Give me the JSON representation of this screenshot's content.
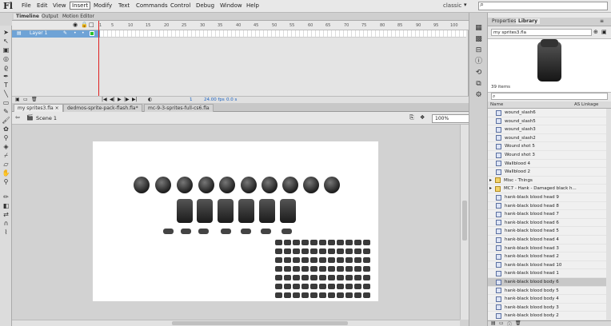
{
  "app": {
    "logo": "Fl",
    "workspace": "classic"
  },
  "menu": [
    "File",
    "Edit",
    "View",
    "Insert",
    "Modify",
    "Text",
    "Commands",
    "Control",
    "Debug",
    "Window",
    "Help"
  ],
  "timeline": {
    "tabs": [
      "Timeline",
      "Output",
      "Motion Editor"
    ],
    "layer_name": "Layer 1",
    "frame_numbers": [
      "1",
      "5",
      "10",
      "15",
      "20",
      "25",
      "30",
      "35",
      "40",
      "45",
      "50",
      "55",
      "60",
      "65",
      "70",
      "75",
      "80",
      "85",
      "90",
      "95",
      "100"
    ],
    "fps": "24.00 fps",
    "time": "0.0 s",
    "current_frame": "1"
  },
  "documents": {
    "tabs": [
      "my sprites3.fla ×",
      "dedmos-sprite-pack-flash.fla*",
      "mc-9-3-sprites-full-cs6.fla"
    ],
    "scene": "Scene 1",
    "zoom": "100%"
  },
  "library": {
    "tabs": [
      "Properties",
      "Library"
    ],
    "file": "my sprites3.fla",
    "item_count": "39 items",
    "col_name": "Name",
    "col_linkage": "AS Linkage",
    "items": [
      {
        "name": "wound_slash6",
        "type": "symbol",
        "indent": 1
      },
      {
        "name": "wound_slash5",
        "type": "symbol",
        "indent": 1
      },
      {
        "name": "wound_slash3",
        "type": "symbol",
        "indent": 1
      },
      {
        "name": "wound_slash2",
        "type": "symbol",
        "indent": 1
      },
      {
        "name": "Wound shot 5",
        "type": "symbol",
        "indent": 1
      },
      {
        "name": "Wound shot 3",
        "type": "symbol",
        "indent": 1
      },
      {
        "name": "Wallblood 4",
        "type": "symbol",
        "indent": 1
      },
      {
        "name": "Wallblood 2",
        "type": "symbol",
        "indent": 1
      },
      {
        "name": "Misc - Things",
        "type": "folder",
        "indent": 0
      },
      {
        "name": "MC7 - Hank - Damaged black h...",
        "type": "folder",
        "indent": 0
      },
      {
        "name": "hank-black blood head 9",
        "type": "symbol",
        "indent": 1
      },
      {
        "name": "hank-black blood head 8",
        "type": "symbol",
        "indent": 1
      },
      {
        "name": "hank-black blood head 7",
        "type": "symbol",
        "indent": 1
      },
      {
        "name": "hank-black blood head 6",
        "type": "symbol",
        "indent": 1
      },
      {
        "name": "hank-black blood head 5",
        "type": "symbol",
        "indent": 1
      },
      {
        "name": "hank-black blood head 4",
        "type": "symbol",
        "indent": 1
      },
      {
        "name": "hank-black blood head 3",
        "type": "symbol",
        "indent": 1
      },
      {
        "name": "hank-black blood head 2",
        "type": "symbol",
        "indent": 1
      },
      {
        "name": "hank-black blood head 10",
        "type": "symbol",
        "indent": 1
      },
      {
        "name": "hank-black blood head 1",
        "type": "symbol",
        "indent": 1
      },
      {
        "name": "hank-black blood body 6",
        "type": "symbol",
        "indent": 1,
        "selected": true
      },
      {
        "name": "hank-black blood body 5",
        "type": "symbol",
        "indent": 1
      },
      {
        "name": "hank-black blood body 4",
        "type": "symbol",
        "indent": 1
      },
      {
        "name": "hank-black blood body 3",
        "type": "symbol",
        "indent": 1
      },
      {
        "name": "hank-black blood body 2",
        "type": "symbol",
        "indent": 1
      }
    ]
  }
}
